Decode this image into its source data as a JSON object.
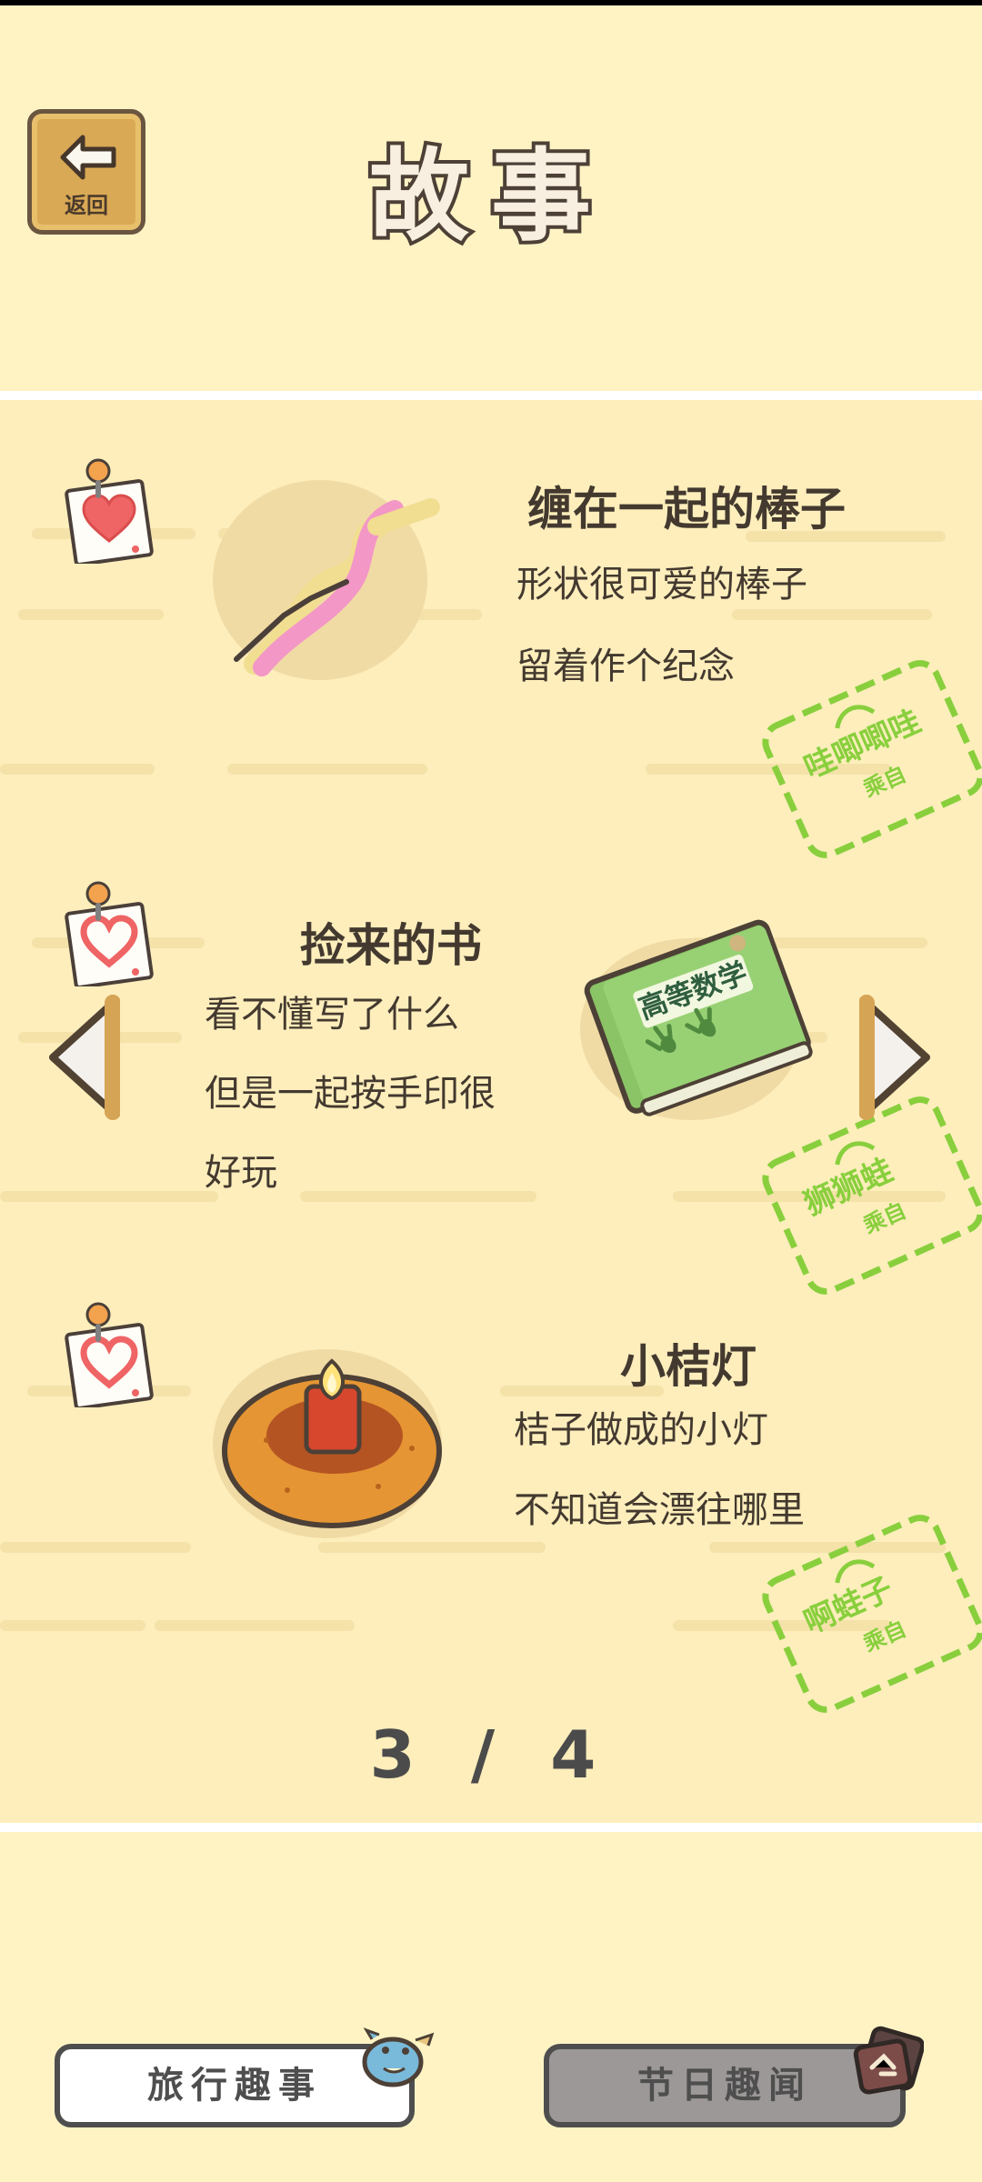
{
  "header": {
    "back_label": "返回",
    "title": "故事"
  },
  "stories": [
    {
      "title": "缠在一起的棒子",
      "lines": [
        "形状很可爱的棒子",
        "留着作个纪念"
      ],
      "stamp_name": "哇唧唧哇",
      "stamp_from": "乘自"
    },
    {
      "title": "捡来的书",
      "lines": [
        "看不懂写了什么",
        "但是一起按手印很",
        "好玩"
      ],
      "book_title": "高等数学",
      "stamp_name": "狮狮蛙",
      "stamp_from": "乘自"
    },
    {
      "title": "小桔灯",
      "lines": [
        "桔子做成的小灯",
        "不知道会漂往哪里"
      ],
      "stamp_name": "啊蛙子",
      "stamp_from": "乘自"
    }
  ],
  "pager": {
    "current": "3",
    "separator": "/",
    "total": "4"
  },
  "bottom_tabs": {
    "travel": "旅行趣事",
    "holiday": "节日趣闻"
  },
  "colors": {
    "background": "#fff3c4",
    "panel": "#fdeebc",
    "text": "#43392f",
    "stamp_green": "#89cf3d",
    "button_gray": "#9c9897",
    "back_wood": "#d9a955"
  },
  "icons": {
    "back": "left-arrow-icon",
    "note": "heart-note-icon",
    "previous": "triangle-left-icon",
    "next": "triangle-right-icon",
    "travel": "bird-icon",
    "holiday": "holiday-stamp-icon"
  }
}
